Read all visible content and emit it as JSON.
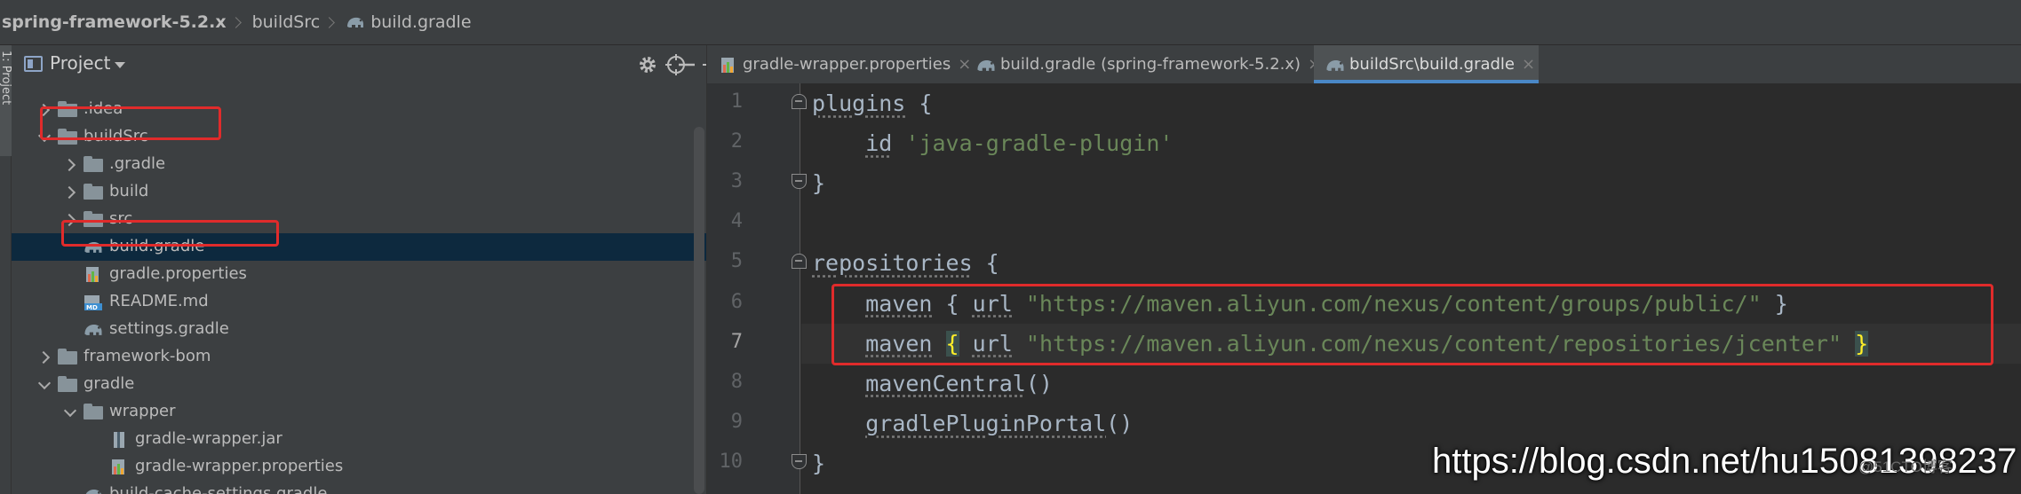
{
  "breadcrumb": [
    "spring-framework-5.2.x",
    "buildSrc",
    "build.gradle"
  ],
  "left_stripe": {
    "label": "1: Project"
  },
  "project_panel": {
    "title": "Project",
    "tree": [
      {
        "label": ".idea",
        "kind": "folder",
        "depth": 1,
        "expanded": false
      },
      {
        "label": "buildSrc",
        "kind": "folder",
        "depth": 1,
        "expanded": true
      },
      {
        "label": ".gradle",
        "kind": "folder",
        "depth": 2,
        "expanded": false
      },
      {
        "label": "build",
        "kind": "folder",
        "depth": 2,
        "expanded": false
      },
      {
        "label": "src",
        "kind": "folder",
        "depth": 2,
        "expanded": false
      },
      {
        "label": "build.gradle",
        "kind": "gradle",
        "depth": 2,
        "selected": true
      },
      {
        "label": "gradle.properties",
        "kind": "properties",
        "depth": 2
      },
      {
        "label": "README.md",
        "kind": "markdown",
        "depth": 2
      },
      {
        "label": "settings.gradle",
        "kind": "gradle",
        "depth": 2
      },
      {
        "label": "framework-bom",
        "kind": "folder",
        "depth": 1,
        "expanded": false
      },
      {
        "label": "gradle",
        "kind": "folder",
        "depth": 1,
        "expanded": true
      },
      {
        "label": "wrapper",
        "kind": "folder",
        "depth": 2,
        "expanded": true
      },
      {
        "label": "gradle-wrapper.jar",
        "kind": "jar",
        "depth": 3
      },
      {
        "label": "gradle-wrapper.properties",
        "kind": "properties",
        "depth": 3
      },
      {
        "label": "build-cache-settings.gradle",
        "kind": "gradle",
        "depth": 2
      }
    ]
  },
  "editor": {
    "tabs": [
      {
        "label": "gradle-wrapper.properties",
        "icon": "properties",
        "active": false
      },
      {
        "label": "build.gradle (spring-framework-5.2.x)",
        "icon": "gradle",
        "active": false
      },
      {
        "label": "buildSrc\\build.gradle",
        "icon": "gradle",
        "active": true
      }
    ],
    "current_line": 7,
    "lines": [
      {
        "n": "1",
        "parts": [
          [
            "u",
            "plugins"
          ],
          [
            "t",
            " {"
          ]
        ]
      },
      {
        "n": "2",
        "parts": [
          [
            "t",
            "    "
          ],
          [
            "u",
            "id"
          ],
          [
            "t",
            " "
          ],
          [
            "s",
            "'java-gradle-plugin'"
          ]
        ]
      },
      {
        "n": "3",
        "parts": [
          [
            "t",
            "}"
          ]
        ]
      },
      {
        "n": "4",
        "parts": []
      },
      {
        "n": "5",
        "parts": [
          [
            "u",
            "repositories"
          ],
          [
            "t",
            " {"
          ]
        ]
      },
      {
        "n": "6",
        "parts": [
          [
            "t",
            "    "
          ],
          [
            "u",
            "maven"
          ],
          [
            "t",
            " { "
          ],
          [
            "u",
            "url"
          ],
          [
            "t",
            " "
          ],
          [
            "s",
            "\"https://maven.aliyun.com/nexus/content/groups/public/\""
          ],
          [
            "t",
            " }"
          ]
        ]
      },
      {
        "n": "7",
        "parts": [
          [
            "t",
            "    "
          ],
          [
            "u",
            "maven"
          ],
          [
            "t",
            " "
          ],
          [
            "b",
            "{"
          ],
          [
            "t",
            " "
          ],
          [
            "u",
            "url"
          ],
          [
            "t",
            " "
          ],
          [
            "s",
            "\"https://maven.aliyun.com/nexus/content/repositories/jcenter\""
          ],
          [
            "t",
            " "
          ],
          [
            "b",
            "}"
          ]
        ]
      },
      {
        "n": "8",
        "parts": [
          [
            "t",
            "    "
          ],
          [
            "u",
            "mavenCentral"
          ],
          [
            "t",
            "()"
          ]
        ]
      },
      {
        "n": "9",
        "parts": [
          [
            "t",
            "    "
          ],
          [
            "u",
            "gradlePluginPortal"
          ],
          [
            "t",
            "()"
          ]
        ]
      },
      {
        "n": "10",
        "parts": [
          [
            "t",
            "}"
          ]
        ]
      }
    ]
  },
  "watermark": "https://blog.csdn.net/hu15081398237",
  "watermark_faint": "@51CTO博客",
  "colors": {
    "background": "#2b2b2b",
    "panel": "#3c3f41",
    "selection": "#0d293e",
    "active_tab_underline": "#4a88c7",
    "string": "#6a8759",
    "identifier": "#a9b7c6",
    "highlight_box": "#e02b2b"
  }
}
